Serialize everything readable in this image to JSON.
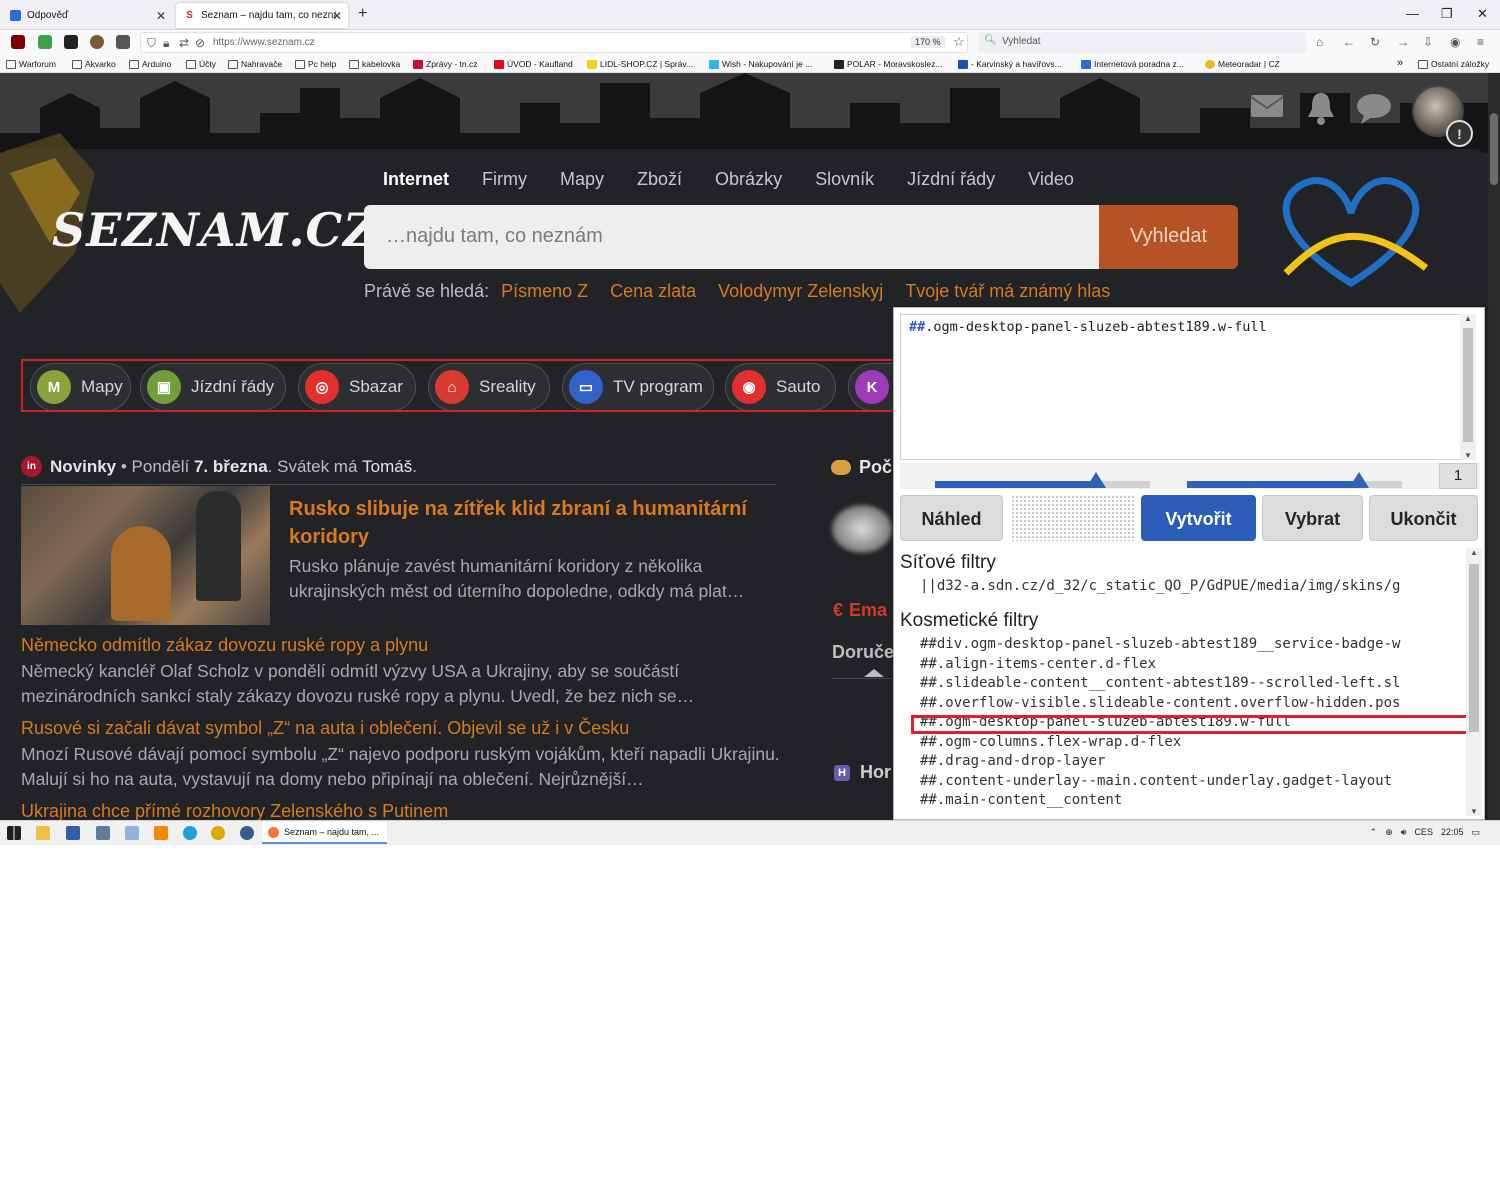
{
  "browser": {
    "tabs": [
      {
        "title": "Odpověď",
        "active": false
      },
      {
        "title": "Seznam – najdu tam, co nezná",
        "active": true
      }
    ],
    "url": "https://www.seznam.cz",
    "zoom": "170 %",
    "search_placeholder": "Vyhledat",
    "bookmarks": [
      "Warforum",
      "Akvarko",
      "Arduino",
      "Účty",
      "Nahravače",
      "Pc help",
      "kabelovka",
      "Zprávy - tn.cz",
      "ÚVOD - Kaufland",
      "LIDL-SHOP.CZ | Správ...",
      "Wish - Nakupování je ...",
      "POLAR - Moravskoslez...",
      "- Karvinský a havířovs...",
      "Internetová poradna z...",
      "Meteoradar | CZ"
    ],
    "other_bookmarks": "Ostatní záložky"
  },
  "seznam": {
    "logo": "SEZNAM.CZ",
    "nav": [
      "Internet",
      "Firmy",
      "Mapy",
      "Zboží",
      "Obrázky",
      "Slovník",
      "Jízdní řády",
      "Video"
    ],
    "search_placeholder": "…najdu tam, co neznám",
    "search_button": "Vyhledat",
    "trending_label": "Právě se hledá:",
    "trending": [
      "Písmeno Z",
      "Cena zlata",
      "Volodymyr Zelenskyj",
      "Tvoje tvář má známý hlas"
    ],
    "services": [
      {
        "label": "Mapy",
        "icon": "M",
        "color": "#8aa33c"
      },
      {
        "label": "Jízdní řády",
        "icon": "▣",
        "color": "#6f9e3a"
      },
      {
        "label": "Sbazar",
        "icon": "◎",
        "color": "#e2312b"
      },
      {
        "label": "Sreality",
        "icon": "⌂",
        "color": "#d93a2f"
      },
      {
        "label": "TV program",
        "icon": "▭",
        "color": "#3262c8"
      },
      {
        "label": "Sauto",
        "icon": "◉",
        "color": "#e02f2f"
      },
      {
        "label": "K",
        "icon": "K",
        "color": "#9c3bb8"
      }
    ],
    "news_source": "Novinky",
    "news_date_prefix": "• Pondělí",
    "news_date": "7. března",
    "news_holiday_prefix": ". Svátek má",
    "news_holiday_name": "Tomáš",
    "lead_title": "Rusko slibuje na zítřek klid zbraní a humanitární koridory",
    "lead_text": "Rusko plánuje zavést humanitární koridory z několika ukrajinských měst od úterního dopoledne, odkdy má plat…",
    "articles": [
      {
        "title": "Německo odmítlo zákaz dovozu ruské ropy a plynu",
        "text": "Německý kancléř Olaf Scholz v pondělí odmítl výzvy USA a Ukrajiny, aby se součástí mezinárodních sankcí staly zákazy dovozu ruské ropy a plynu. Uvedl, že bez nich se…"
      },
      {
        "title": "Rusové si začali dávat symbol „Z“ na auta i oblečení. Objevil se už i v Česku",
        "text": "Mnozí Rusové dávají pomocí symbolu „Z“ najevo podporu ruským vojákům, kteří napadli Ukrajinu. Malují si ho na auta, vystavují na domy nebo připínají na oblečení. Nejrůznější…"
      },
      {
        "title": "Ukrajina chce přímé rozhovory Zelenského s Putinem",
        "text": ""
      }
    ],
    "side": {
      "weather": "Poč",
      "email": "Ema",
      "email_icon": "€",
      "deliver": "Doruče",
      "horoscope": "Hor",
      "horoscope_icon": "H"
    },
    "header_icons": [
      "envelope-icon",
      "bell-icon",
      "chat-icon"
    ],
    "help_badge": "!"
  },
  "picker": {
    "filter_hash": "##",
    "filter_rest": ".ogm-desktop-panel-sluzeb-abtest189.w-full",
    "counter": "1",
    "slider_left": 0.75,
    "slider_right": 0.8,
    "buttons": {
      "preview": "Náhled",
      "create": "Vytvořit",
      "pick": "Vybrat",
      "quit": "Ukončit"
    },
    "network_title": "Síťové filtry",
    "network_filter": "||d32-a.sdn.cz/d_32/c_static_QO_P/GdPUE/media/img/skins/g",
    "cosmetic_title": "Kosmetické filtry",
    "cosmetic": [
      "##div.ogm-desktop-panel-sluzeb-abtest189__service-badge-w",
      "##.align-items-center.d-flex",
      "##.slideable-content__content-abtest189--scrolled-left.sl",
      "##.overflow-visible.slideable-content.overflow-hidden.pos",
      "##.ogm-desktop-panel-sluzeb-abtest189.w-full",
      "##.ogm-columns.flex-wrap.d-flex",
      "##.drag-and-drop-layer",
      "##.content-underlay--main.content-underlay.gadget-layout",
      "##.main-content__content"
    ],
    "highlighted_index": 4
  },
  "taskbar": {
    "app": "Seznam – najdu tam, ...",
    "lang": "CES",
    "time": "22:05"
  },
  "colors": {
    "accent": "#d87a1d",
    "picker_blue": "#2b5cb8",
    "highlight_red": "#e0202a"
  }
}
